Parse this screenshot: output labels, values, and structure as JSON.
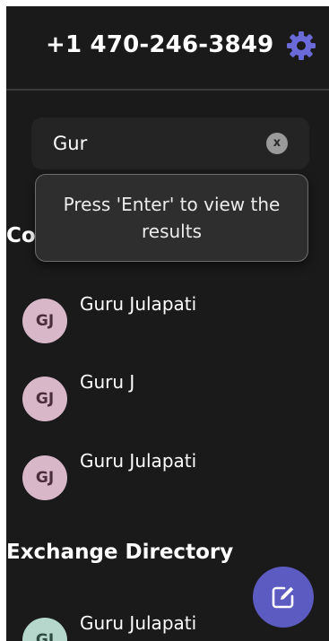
{
  "header": {
    "phone_number": "+1 470-246-3849",
    "settings_icon": "gear-icon"
  },
  "search": {
    "value": "Gur",
    "clear_label": "x"
  },
  "tooltip": {
    "text": "Press 'Enter' to view the results"
  },
  "sections": {
    "contacts_title": "Co",
    "directory_title": "Exchange Directory"
  },
  "contacts": [
    {
      "initials": "GJ",
      "name": "Guru Julapati"
    },
    {
      "initials": "GJ",
      "name": "Guru J"
    },
    {
      "initials": "GJ",
      "name": "Guru Julapati"
    }
  ],
  "directory": [
    {
      "initials": "GJ",
      "name": "Guru Julapati"
    }
  ],
  "fab": {
    "icon": "compose-icon"
  },
  "colors": {
    "background": "#1a1a1a",
    "accent": "#5c5bc2",
    "contact_avatar": "#d8b7c8",
    "directory_avatar": "#b6d8cc"
  }
}
